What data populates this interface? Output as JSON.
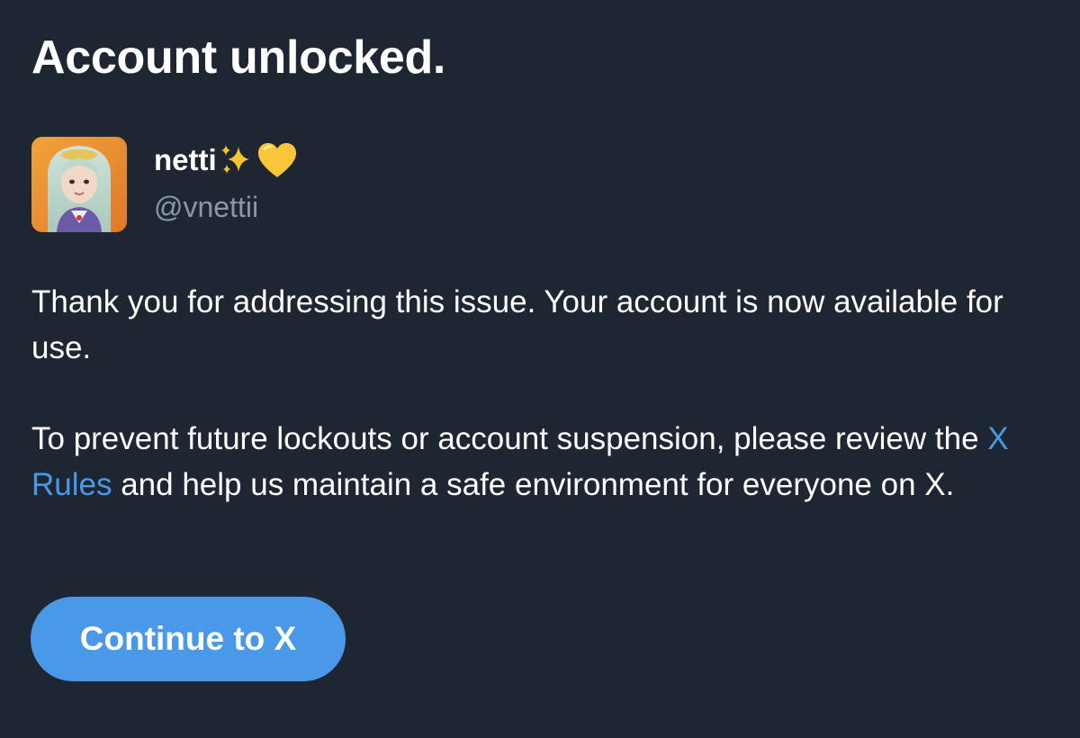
{
  "page": {
    "title": "Account unlocked."
  },
  "profile": {
    "display_name": "netti",
    "name_emojis": [
      "sparkles-icon",
      "yellow-heart-icon"
    ],
    "handle": "@vnettii"
  },
  "message": {
    "paragraph1": "Thank you for addressing this issue. Your account is now available for use.",
    "paragraph2_before": "To prevent future lockouts or account suspension, please review the ",
    "rules_link": "X Rules",
    "paragraph2_after": " and help us maintain a safe environment for everyone on X."
  },
  "actions": {
    "continue_label": "Continue to X"
  },
  "colors": {
    "background": "#1e2632",
    "text": "#ffffff",
    "muted": "#8b98a5",
    "accent": "#4a99e9"
  }
}
